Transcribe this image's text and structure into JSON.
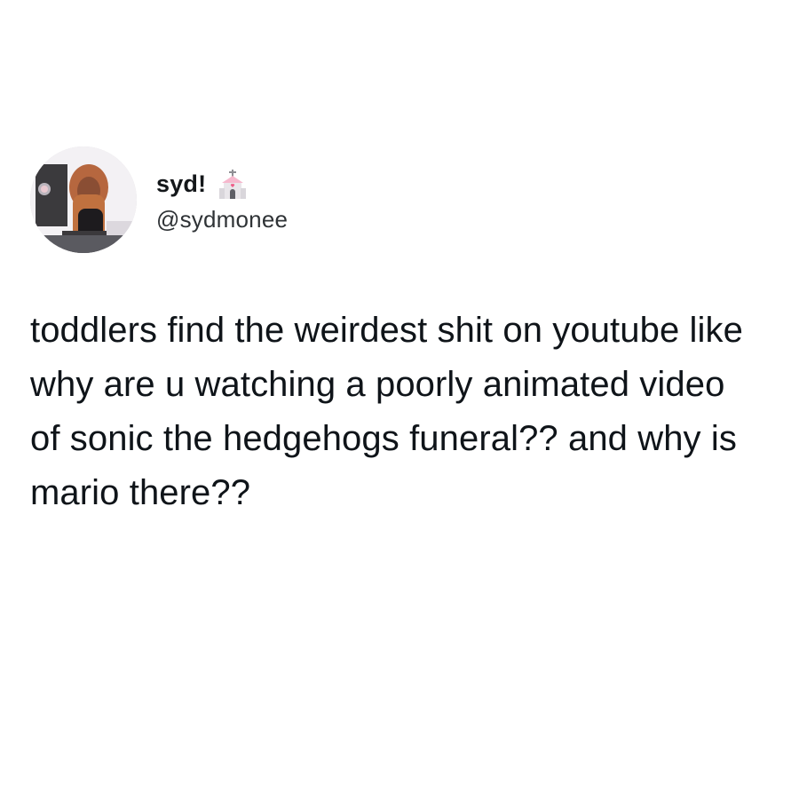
{
  "tweet": {
    "display_name": "syd!",
    "name_emoji": "wedding-chapel-icon",
    "handle": "@sydmonee",
    "text": "toddlers find the weirdest shit on youtube like why are u watching a poorly animated video of sonic the hedgehogs funeral?? and why is mario there??"
  },
  "colors": {
    "background": "#ffffff",
    "text": "#0f1419",
    "handle": "#2f3336",
    "emoji_pink": "#f6b8cd",
    "emoji_gray": "#9aa0a6"
  }
}
